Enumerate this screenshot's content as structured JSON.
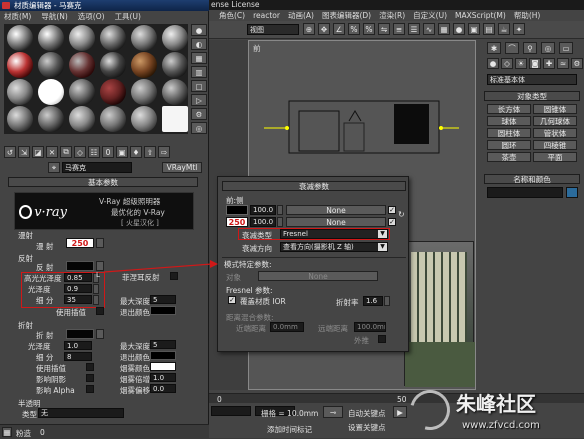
{
  "mat_editor": {
    "title": "材质编辑器 - 马赛克",
    "menu": [
      "材质(M)",
      "导航(N)",
      "选项(O)",
      "工具(U)"
    ],
    "mat_name": "马赛克",
    "mat_type": "VRayMtl",
    "basic_params": "基本参数",
    "vray_banner": {
      "title": "V-Ray 超级照明器",
      "subtitle": "最优化的 V-Ray",
      "edition": "[ 火星汉化 ]"
    },
    "diffuse_group": "漫射",
    "diffuse_label": "漫  射",
    "diffuse_value": "250",
    "refl_group": "反射",
    "refl_label": "反  射",
    "hilight_label": "高光光泽度",
    "hilight_value": "0.85",
    "refl_gloss_label": "光泽度",
    "refl_gloss_value": "0.9",
    "subdivs_label": "细  分",
    "subdivs_value": "35",
    "fresnel_label": "菲涅耳反射",
    "max_depth_label": "最大深度",
    "max_depth_value": "5",
    "exit_color_label": "退出颜色",
    "use_interp_label": "使用插值",
    "refr_group": "折射",
    "refr_label": "折  射",
    "refr_gloss_label": "光泽度",
    "refr_gloss_value": "1.0",
    "refr_subdivs_label": "细  分",
    "refr_subdivs_value": "8",
    "refr_max_depth_label": "最大深度",
    "refr_max_depth_value": "5",
    "refr_exit_label": "退出颜色",
    "refr_interp_label": "使用插值",
    "affect_shadow_label": "影响阴影",
    "affect_alpha_label": "影响 Alpha",
    "fog_color_label": "烟雾颜色",
    "fog_mult_label": "烟雾倍增",
    "fog_mult_value": "1.0",
    "fog_bias_label": "烟雾偏移",
    "fog_bias_value": "0.0",
    "translucency_group": "半透明",
    "type_label": "类型",
    "type_value": "无",
    "status_label": "粉造",
    "status_value": "0"
  },
  "falloff": {
    "title": "衰减参数",
    "front_side": "前:侧",
    "row1_value": "100.0",
    "row1_map": "None",
    "row2_color_value": "250",
    "row2_value": "100.0",
    "row2_map": "None",
    "type_label": "衰减类型",
    "type_value": "Fresnel",
    "dir_label": "衰减方向",
    "dir_value": "查看方向(摄影机 Z 轴)",
    "mode_title": "模式特定参数:",
    "object_label": "对象",
    "object_value": "None",
    "fresnel_params": "Fresnel 参数:",
    "override_ior_label": "覆盖材质 IOR",
    "ior_label": "折射率",
    "ior_value": "1.6",
    "dist_blend_label": "距离混合参数:",
    "near_label": "近端距离",
    "near_value": "0.0mm",
    "far_label": "远端距离",
    "far_value": "100.0mm",
    "extrapolate_label": "外推"
  },
  "max_main": {
    "title_fragment": "ense License",
    "menu": [
      "角色(C)",
      "reactor",
      "动画(A)",
      "图表编辑器(D)",
      "渲染(R)",
      "自定义(U)",
      "MAXScript(M)",
      "帮助(H)"
    ],
    "view_dropdown": "视图",
    "viewport_label": "前",
    "grid_label": "栅格 = 10.0mm",
    "auto_key": "自动关键点",
    "set_key": "设置关键点",
    "add_time_tag": "添加时间标记",
    "time_value": "0",
    "frames_value": "50"
  },
  "cmd_panel": {
    "dropdown": "标准基本体",
    "object_type": "对象类型",
    "buttons": [
      "长方体",
      "圆锥体",
      "球体",
      "几何球体",
      "圆柱体",
      "管状体",
      "圆环",
      "四棱锥",
      "茶壶",
      "平面"
    ],
    "name_color": "名称和颜色"
  },
  "watermark": {
    "site": "朱峰社区",
    "url": "www.zfvcd.com"
  },
  "colors": {
    "highlight_red": "#d01818",
    "panel_bg": "#444444",
    "dark_bg": "#2b2b2b"
  }
}
